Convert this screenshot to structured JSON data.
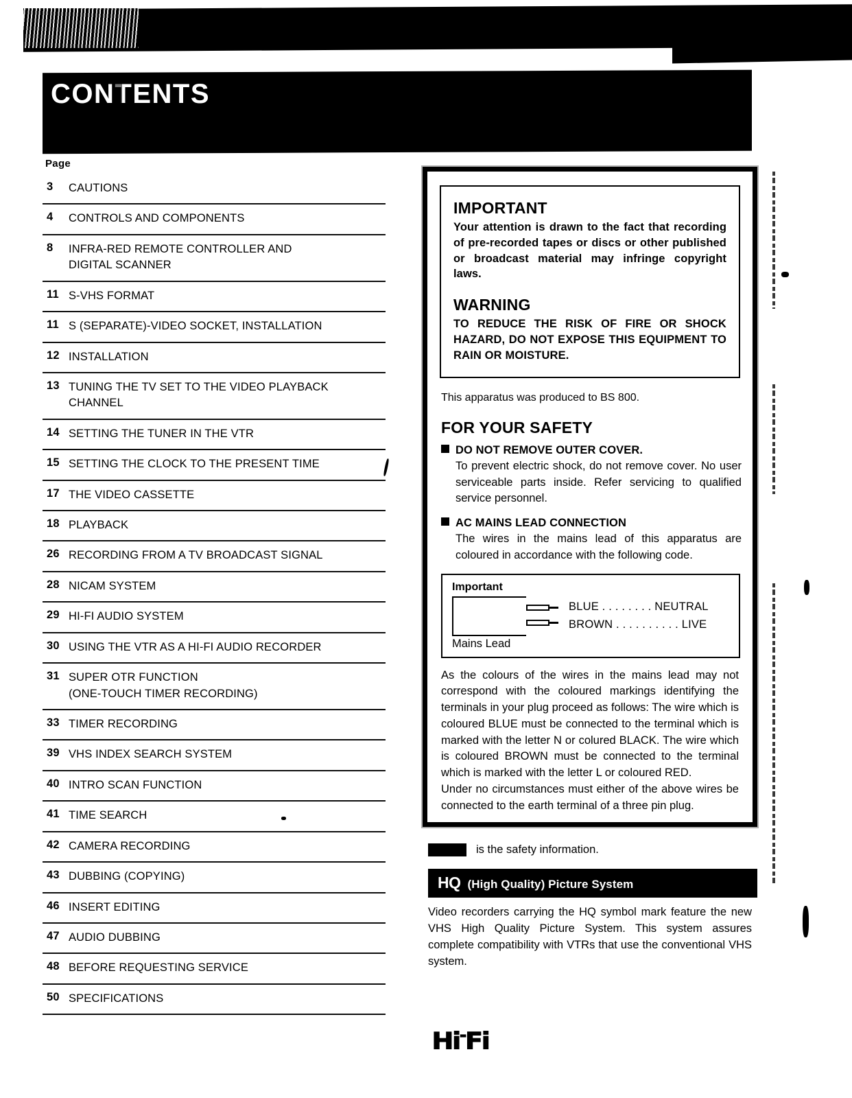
{
  "masthead": {
    "title_a": "CON",
    "title_b": "TE",
    "title_c": "NTS"
  },
  "toc": {
    "page_label": "Page",
    "entries": [
      {
        "page": "3",
        "title": "CAUTIONS"
      },
      {
        "page": "4",
        "title": "CONTROLS AND COMPONENTS"
      },
      {
        "page": "8",
        "title": "INFRA-RED REMOTE CONTROLLER AND\nDIGITAL SCANNER"
      },
      {
        "page": "11",
        "title": "S-VHS FORMAT"
      },
      {
        "page": "11",
        "title": "S (SEPARATE)-VIDEO SOCKET, INSTALLATION"
      },
      {
        "page": "12",
        "title": "INSTALLATION"
      },
      {
        "page": "13",
        "title": "TUNING THE TV SET TO THE VIDEO PLAYBACK\nCHANNEL"
      },
      {
        "page": "14",
        "title": "SETTING THE TUNER IN THE VTR"
      },
      {
        "page": "15",
        "title": "SETTING THE CLOCK TO THE PRESENT TIME"
      },
      {
        "page": "17",
        "title": "THE VIDEO CASSETTE"
      },
      {
        "page": "18",
        "title": "PLAYBACK"
      },
      {
        "page": "26",
        "title": "RECORDING FROM A TV BROADCAST SIGNAL"
      },
      {
        "page": "28",
        "title": "NICAM SYSTEM"
      },
      {
        "page": "29",
        "title": "HI-FI AUDIO SYSTEM"
      },
      {
        "page": "30",
        "title": "USING THE VTR AS A HI-FI AUDIO RECORDER"
      },
      {
        "page": "31",
        "title": "SUPER OTR FUNCTION\n(ONE-TOUCH TIMER RECORDING)"
      },
      {
        "page": "33",
        "title": "TIMER RECORDING"
      },
      {
        "page": "39",
        "title": "VHS INDEX SEARCH SYSTEM"
      },
      {
        "page": "40",
        "title": "INTRO SCAN FUNCTION"
      },
      {
        "page": "41",
        "title": "TIME SEARCH"
      },
      {
        "page": "42",
        "title": "CAMERA RECORDING"
      },
      {
        "page": "43",
        "title": "DUBBING (COPYING)"
      },
      {
        "page": "46",
        "title": "INSERT EDITING"
      },
      {
        "page": "47",
        "title": "AUDIO DUBBING"
      },
      {
        "page": "48",
        "title": "BEFORE REQUESTING SERVICE"
      },
      {
        "page": "50",
        "title": "SPECIFICATIONS"
      }
    ]
  },
  "safety": {
    "important_heading": "IMPORTANT",
    "important_body": "Your attention is drawn to the fact that recording of pre-recorded tapes or discs or other published or broadcast material may infringe copyright laws.",
    "warning_heading": "WARNING",
    "warning_body": "TO REDUCE THE RISK OF FIRE OR SHOCK HAZARD, DO NOT EXPOSE THIS EQUIPMENT TO RAIN OR MOISTURE.",
    "bs_note": "This apparatus was produced to BS 800.",
    "for_your_safety_heading": "FOR YOUR SAFETY",
    "bullets": [
      {
        "heading": "DO NOT REMOVE OUTER COVER.",
        "body": "To prevent electric shock, do not remove cover. No user serviceable parts inside. Refer servicing to qualified service personnel."
      },
      {
        "heading": "AC MAINS LEAD CONNECTION",
        "body": "The wires in the mains lead of this apparatus are coloured in accordance with the following code."
      }
    ],
    "mains_diagram": {
      "label": "Important",
      "wire_blue": "BLUE . . . . . . . . NEUTRAL",
      "wire_brown": "BROWN . . . . . . . . . .  LIVE",
      "foot": "Mains Lead"
    },
    "mains_text": "As the colours of the wires in the mains lead may not correspond with the coloured markings identifying the terminals in your plug proceed as follows: The wire which is coloured BLUE must be connected to the terminal which is marked with the letter N or colured BLACK. The wire which is coloured BROWN must be connected to the terminal which is marked with the letter L or coloured RED.",
    "mains_text2": "Under no circumstances must either of the above wires be connected to the earth terminal of a three pin plug.",
    "safety_info_text": "is the safety information."
  },
  "hq": {
    "mark": "HQ",
    "caption": "(High Quality) Picture System",
    "body": "Video recorders carrying the HQ symbol mark feature the new VHS High Quality Picture System. This system assures complete compatibility with VTRs that use the conventional VHS system."
  },
  "logo": {
    "text_1": "Hi",
    "text_2": "Fi"
  }
}
